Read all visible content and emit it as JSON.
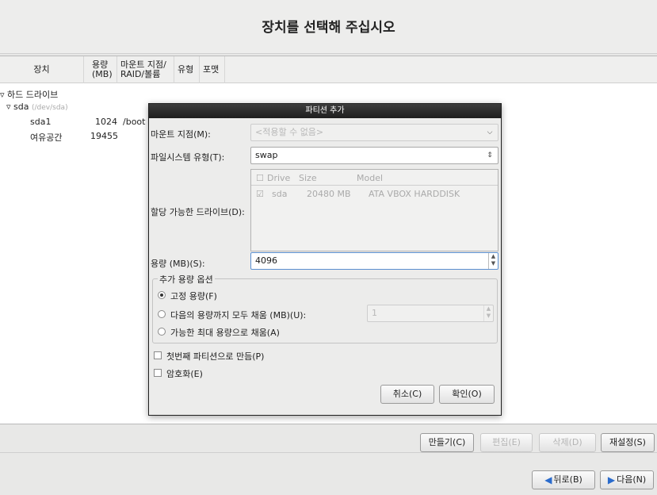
{
  "header": {
    "title": "장치를 선택해 주십시오"
  },
  "table": {
    "headers": {
      "device": "장치",
      "size_1": "용량",
      "size_2": "(MB)",
      "mount_1": "마운트 지점/",
      "mount_2": "RAID/볼륨",
      "type": "유형",
      "format": "포맷"
    },
    "tree": {
      "hard_drives": "하드 드라이브",
      "sda_name": "sda",
      "sda_path": "(/dev/sda)",
      "rows": [
        {
          "name": "sda1",
          "size": "1024",
          "mount": "/boot"
        },
        {
          "name": "여유공간",
          "size": "19455",
          "mount": ""
        }
      ]
    }
  },
  "dialog": {
    "title": "파티션 추가",
    "mount_label": "마운트 지점(M):",
    "mount_value": "<적용할 수 없음>",
    "fs_label": "파일시스템 유형(T):",
    "fs_value": "swap",
    "drives_label": "할당 가능한 드라이브(D):",
    "drive_columns": {
      "drive": "Drive",
      "size": "Size",
      "model": "Model"
    },
    "drive_row": {
      "drive": "sda",
      "size": "20480 MB",
      "model": "ATA VBOX HARDDISK",
      "checked": true
    },
    "size_label": "용량 (MB)(S):",
    "size_value": "4096",
    "options_title": "추가 용량 옵션",
    "opt_fixed": "고정 용량(F)",
    "opt_fill_upto": "다음의 용량까지 모두 채움 (MB)(U):",
    "opt_fill_upto_value": "1",
    "opt_fill_max": "가능한 최대 용량으로 채움(A)",
    "primary_label": "첫번째 파티션으로 만듬(P)",
    "encrypt_label": "암호화(E)",
    "cancel": "취소(C)",
    "ok": "확인(O)"
  },
  "actions": {
    "create": "만들기(C)",
    "edit": "편집(E)",
    "delete": "삭제(D)",
    "reset": "재설정(S)"
  },
  "nav": {
    "back": "뒤로(B)",
    "next": "다음(N)"
  }
}
